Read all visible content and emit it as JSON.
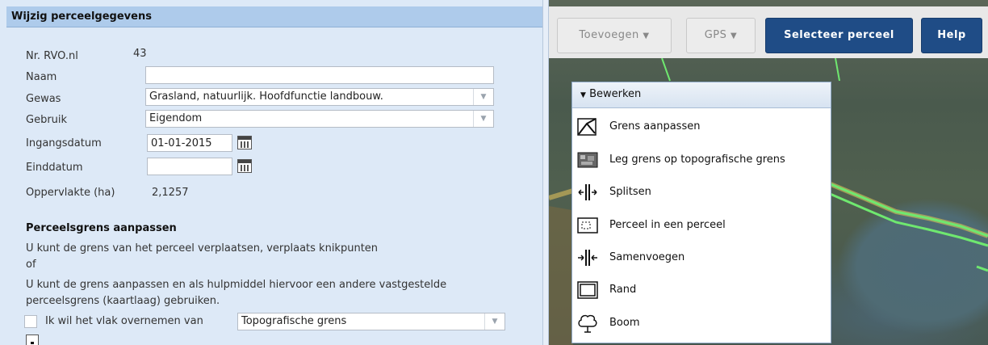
{
  "form": {
    "title": "Wijzig perceelgegevens",
    "nr_label": "Nr. RVO.nl",
    "nr_value": "43",
    "naam_label": "Naam",
    "naam_value": "",
    "gewas_label": "Gewas",
    "gewas_value": "Grasland, natuurlijk. Hoofdfunctie landbouw.",
    "gebruik_label": "Gebruik",
    "gebruik_value": "Eigendom",
    "ingangsdatum_label": "Ingangsdatum",
    "ingangsdatum_value": "01-01-2015",
    "einddatum_label": "Einddatum",
    "einddatum_value": "",
    "oppervlakte_label": "Oppervlakte (ha)",
    "oppervlakte_value": "2,1257",
    "section_title": "Perceelsgrens aanpassen",
    "para1": "U kunt de grens van het perceel verplaatsen, verplaats knikpunten",
    "para_of": "of",
    "para2a": "U kunt de grens aanpassen en als hulpmiddel hiervoor een andere vastgestelde",
    "para2b": "perceelsgrens (kaartlaag) gebruiken.",
    "checkbox_label": "Ik wil het vlak overnemen van",
    "overnemen_value": "Topografische grens"
  },
  "toolbar": {
    "toevoegen": "Toevoegen",
    "gps": "GPS",
    "selecteer": "Selecteer perceel",
    "help": "Help"
  },
  "menu": {
    "header": "Bewerken",
    "items": [
      {
        "label": "Grens aanpassen",
        "icon": "edit-boundary-icon"
      },
      {
        "label": "Leg grens op topografische grens",
        "icon": "topographic-map-icon"
      },
      {
        "label": "Splitsen",
        "icon": "split-icon"
      },
      {
        "label": "Perceel in een perceel",
        "icon": "parcel-in-parcel-icon"
      },
      {
        "label": "Samenvoegen",
        "icon": "merge-icon"
      },
      {
        "label": "Rand",
        "icon": "border-icon"
      },
      {
        "label": "Boom",
        "icon": "tree-icon"
      }
    ]
  },
  "colors": {
    "primary": "#1f4c86",
    "panel": "#dde9f7",
    "header": "#aecbeb",
    "map_line": "#6fe86f"
  }
}
